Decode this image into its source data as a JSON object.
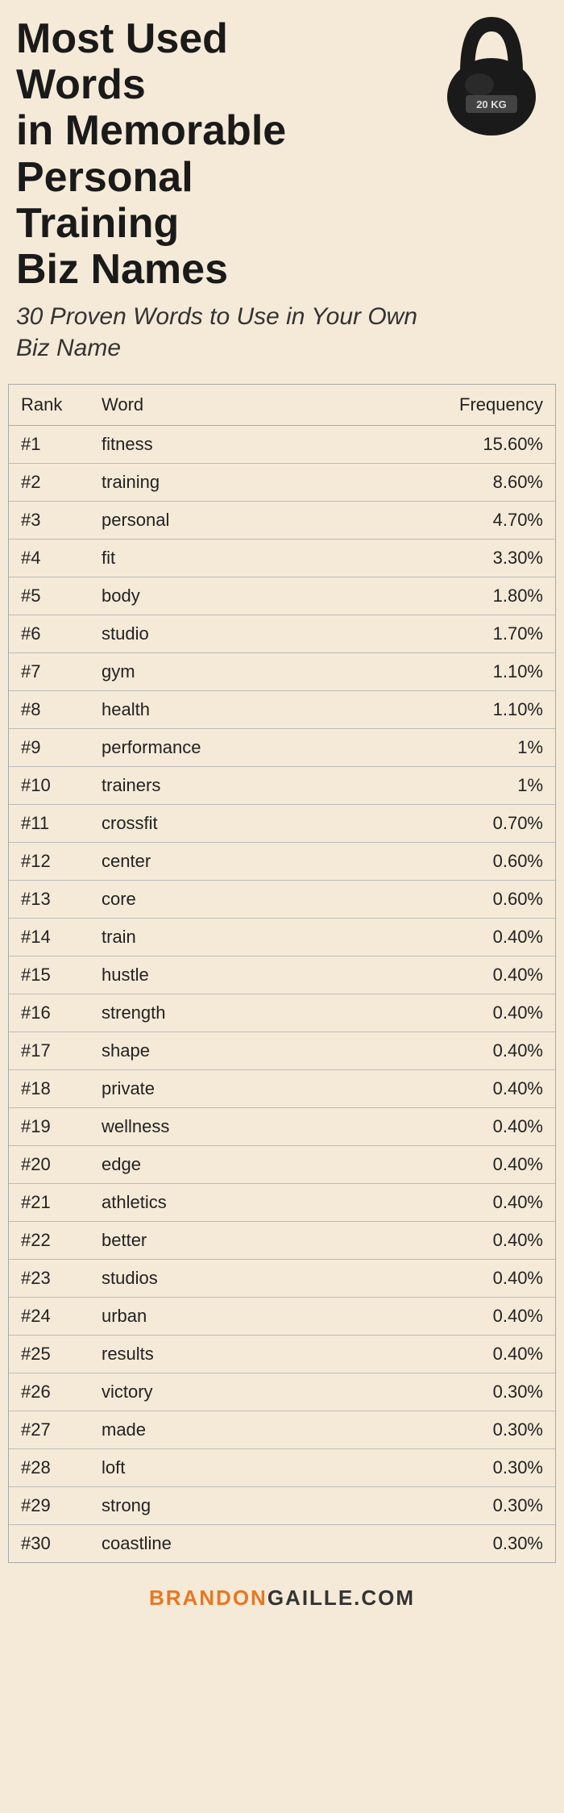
{
  "header": {
    "title_line1": "Most Used Words",
    "title_line2": "in Memorable",
    "title_line3": "Personal Training",
    "title_line4": "Biz Names",
    "subtitle": "30 Proven Words to Use in Your Own Biz Name"
  },
  "table": {
    "columns": {
      "rank": "Rank",
      "word": "Word",
      "frequency": "Frequency"
    },
    "rows": [
      {
        "rank": "#1",
        "word": "fitness",
        "frequency": "15.60%"
      },
      {
        "rank": "#2",
        "word": "training",
        "frequency": "8.60%"
      },
      {
        "rank": "#3",
        "word": "personal",
        "frequency": "4.70%"
      },
      {
        "rank": "#4",
        "word": "fit",
        "frequency": "3.30%"
      },
      {
        "rank": "#5",
        "word": "body",
        "frequency": "1.80%"
      },
      {
        "rank": "#6",
        "word": "studio",
        "frequency": "1.70%"
      },
      {
        "rank": "#7",
        "word": "gym",
        "frequency": "1.10%"
      },
      {
        "rank": "#8",
        "word": "health",
        "frequency": "1.10%"
      },
      {
        "rank": "#9",
        "word": "performance",
        "frequency": "1%"
      },
      {
        "rank": "#10",
        "word": "trainers",
        "frequency": "1%"
      },
      {
        "rank": "#11",
        "word": "crossfit",
        "frequency": "0.70%"
      },
      {
        "rank": "#12",
        "word": "center",
        "frequency": "0.60%"
      },
      {
        "rank": "#13",
        "word": "core",
        "frequency": "0.60%"
      },
      {
        "rank": "#14",
        "word": "train",
        "frequency": "0.40%"
      },
      {
        "rank": "#15",
        "word": "hustle",
        "frequency": "0.40%"
      },
      {
        "rank": "#16",
        "word": "strength",
        "frequency": "0.40%"
      },
      {
        "rank": "#17",
        "word": "shape",
        "frequency": "0.40%"
      },
      {
        "rank": "#18",
        "word": "private",
        "frequency": "0.40%"
      },
      {
        "rank": "#19",
        "word": "wellness",
        "frequency": "0.40%"
      },
      {
        "rank": "#20",
        "word": "edge",
        "frequency": "0.40%"
      },
      {
        "rank": "#21",
        "word": "athletics",
        "frequency": "0.40%"
      },
      {
        "rank": "#22",
        "word": "better",
        "frequency": "0.40%"
      },
      {
        "rank": "#23",
        "word": "studios",
        "frequency": "0.40%"
      },
      {
        "rank": "#24",
        "word": "urban",
        "frequency": "0.40%"
      },
      {
        "rank": "#25",
        "word": "results",
        "frequency": "0.40%"
      },
      {
        "rank": "#26",
        "word": "victory",
        "frequency": "0.30%"
      },
      {
        "rank": "#27",
        "word": "made",
        "frequency": "0.30%"
      },
      {
        "rank": "#28",
        "word": "loft",
        "frequency": "0.30%"
      },
      {
        "rank": "#29",
        "word": "strong",
        "frequency": "0.30%"
      },
      {
        "rank": "#30",
        "word": "coastline",
        "frequency": "0.30%"
      }
    ]
  },
  "footer": {
    "brand_orange": "BRANDON",
    "brand_dark": "GAILLE.COM"
  }
}
